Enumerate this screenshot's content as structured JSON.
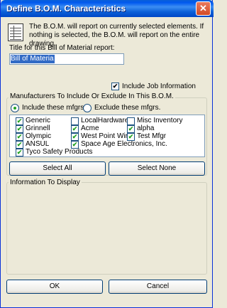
{
  "window": {
    "title": "Define B.O.M. Characteristics",
    "close_symbol": "✕"
  },
  "intro_text": "The B.O.M. will report on currently selected elements. If nothing is selected, the B.O.M. will report on the entire drawing.",
  "report_title": {
    "label": "Title for this Bill of Material report:",
    "value": "Bill of Materia"
  },
  "include_job": {
    "label": "Include Job Information",
    "checked": true
  },
  "manufacturers": {
    "group_label": "Manufacturers To Include Or Exclude In This B.O.M.",
    "include_label": "Include these mfgrs.",
    "exclude_label": "Exclude these mfgrs.",
    "mode": "include",
    "items": [
      {
        "label": "Generic",
        "checked": true
      },
      {
        "label": "LocalHardware",
        "checked": false
      },
      {
        "label": "Misc Inventory",
        "checked": false
      },
      {
        "label": "Grinnell",
        "checked": true
      },
      {
        "label": "Acme",
        "checked": true
      },
      {
        "label": "alpha",
        "checked": true
      },
      {
        "label": "Olympic",
        "checked": true
      },
      {
        "label": "West Point Wire",
        "checked": true
      },
      {
        "label": "Test Mfgr",
        "checked": true
      },
      {
        "label": "ANSUL",
        "checked": true
      },
      {
        "label": "Space Age Electronics, Inc.",
        "checked": true
      },
      {
        "label": "Tyco Safety Products",
        "checked": true
      }
    ],
    "select_all_label": "Select All",
    "select_none_label": "Select None"
  },
  "info_group": {
    "label": "Information To Display"
  },
  "buttons": {
    "ok": "OK",
    "cancel": "Cancel"
  },
  "colors": {
    "title_blue": "#0a5fd8",
    "check_green": "#21a121",
    "dialog_bg": "#ece9d8",
    "selection": "#316ac5"
  }
}
